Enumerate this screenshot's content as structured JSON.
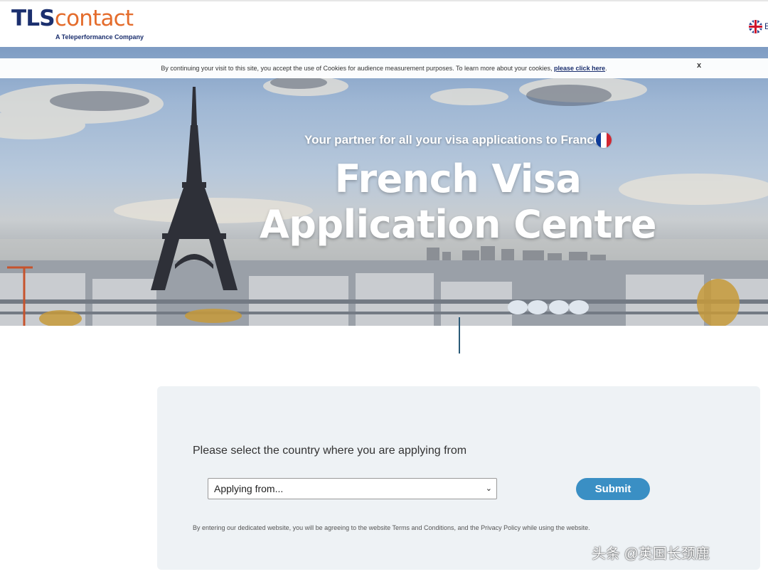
{
  "header": {
    "logo_tls": "TLS",
    "logo_contact": "contact",
    "logo_subtitle": "A Teleperformance Company",
    "language_code": "E"
  },
  "cookie_banner": {
    "text": "By continuing your visit to this site, you accept the use of Cookies for audience measurement purposes. To learn more about your cookies, ",
    "link": "please click here",
    "suffix": ".",
    "close": "x"
  },
  "hero": {
    "tagline": "Your partner for all your visa applications to France",
    "title_line1": "French Visa",
    "title_line2": "Application Centre"
  },
  "form": {
    "prompt": "Please select the country where you are applying from",
    "select_value": "Applying from...",
    "submit_label": "Submit",
    "terms": "By entering our dedicated website, you will be agreeing to the website Terms and Conditions, and the Privacy Policy while using the website."
  },
  "watermark": "头条 @英国长颈鹿",
  "colors": {
    "brand_navy": "#1b2f6e",
    "brand_orange": "#e46c2c",
    "submit_blue": "#3a8fc4",
    "panel_bg": "#eef2f5"
  }
}
